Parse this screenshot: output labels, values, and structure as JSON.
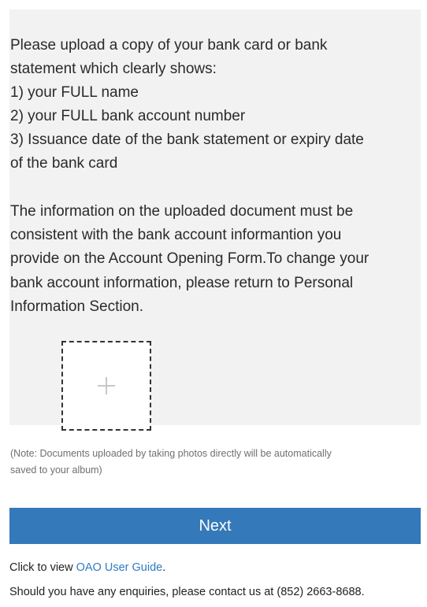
{
  "instructions": {
    "lines": [
      "Please upload a copy of your bank card or bank",
      "statement which clearly shows:",
      "1) your FULL name",
      "2) your FULL bank account number",
      "3) Issuance date of the bank statement or expiry date",
      "of the bank card"
    ]
  },
  "consistency": {
    "lines": [
      "The information on the uploaded document must be",
      "consistent with the bank account informantion you",
      "provide on the Account Opening Form.To change your",
      "bank account information, please return to Personal",
      "Information Section."
    ]
  },
  "upload": {
    "icon": "plus-icon"
  },
  "note": {
    "lines": [
      "(Note: Documents uploaded by taking photos directly will be automatically",
      "saved to your album)"
    ]
  },
  "next_button": {
    "label": "Next",
    "color": "#3479b9"
  },
  "guide": {
    "prefix": "Click to view ",
    "link_text": "OAO User Guide",
    "suffix": "."
  },
  "contact": {
    "text": "Should you have any enquiries, please contact us at (852) 2663-8688."
  }
}
